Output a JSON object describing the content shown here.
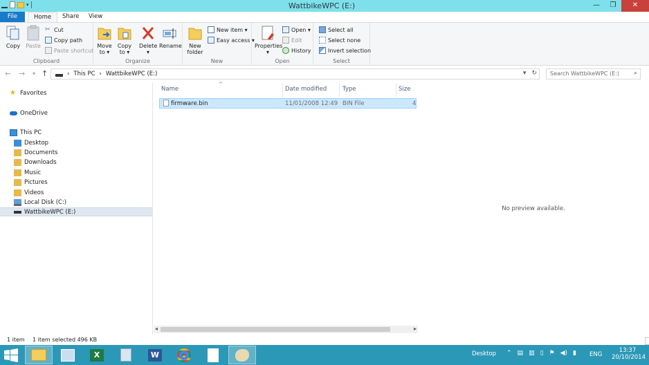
{
  "window": {
    "title": "WattbikeWPC (E:)"
  },
  "window_controls": {
    "minimize": "—",
    "restore": "❐",
    "close": "✕"
  },
  "ribbon_tabs": {
    "file": "File",
    "home": "Home",
    "share": "Share",
    "view": "View"
  },
  "ribbon": {
    "clipboard": {
      "copy": "Copy",
      "paste": "Paste",
      "cut": "Cut",
      "copy_path": "Copy path",
      "paste_shortcut": "Paste shortcut",
      "label": "Clipboard"
    },
    "organize": {
      "move_to_1": "Move",
      "move_to_2": "to ▾",
      "copy_to_1": "Copy",
      "copy_to_2": "to ▾",
      "delete_1": "Delete",
      "delete_2": "▾",
      "rename": "Rename",
      "label": "Organize"
    },
    "new": {
      "new_folder_1": "New",
      "new_folder_2": "folder",
      "new_item": "New item ▾",
      "easy_access": "Easy access ▾",
      "label": "New"
    },
    "open": {
      "properties_1": "Properties",
      "properties_2": "▾",
      "open": "Open ▾",
      "edit": "Edit",
      "history": "History",
      "label": "Open"
    },
    "select": {
      "select_all": "Select all",
      "select_none": "Select none",
      "invert_selection": "Invert selection",
      "label": "Select"
    }
  },
  "address": {
    "back": "←",
    "forward": "→",
    "recent": "▾",
    "up": "↑",
    "crumbs": [
      "This PC",
      "WattbikeWPC (E:)"
    ],
    "sep": "›",
    "dropdown": "▾",
    "refresh": "↻"
  },
  "search": {
    "placeholder": "Search WattbikeWPC (E:)"
  },
  "nav": {
    "favorites": "Favorites",
    "onedrive": "OneDrive",
    "this_pc": "This PC",
    "items": [
      "Desktop",
      "Documents",
      "Downloads",
      "Music",
      "Pictures",
      "Videos",
      "Local Disk (C:)",
      "WattbikeWPC (E:)"
    ]
  },
  "columns": {
    "name": "Name",
    "date": "Date modified",
    "type": "Type",
    "size": "Size"
  },
  "files": [
    {
      "name": "firmware.bin",
      "date": "11/01/2008 12:49",
      "type": "BIN File",
      "size": "4"
    }
  ],
  "preview": {
    "message": "No preview available."
  },
  "status": {
    "count": "1 item",
    "selected": "1 item selected  496 KB"
  },
  "taskbar": {
    "desktop_label": "Desktop",
    "language": "ENG",
    "time": "13:37",
    "date": "20/10/2014"
  },
  "colors": {
    "title_bg": "#7de0ea",
    "file_tab": "#1979ca",
    "close_btn": "#c8413a",
    "selection": "#cce8ff",
    "taskbar": "#2c98b7"
  }
}
